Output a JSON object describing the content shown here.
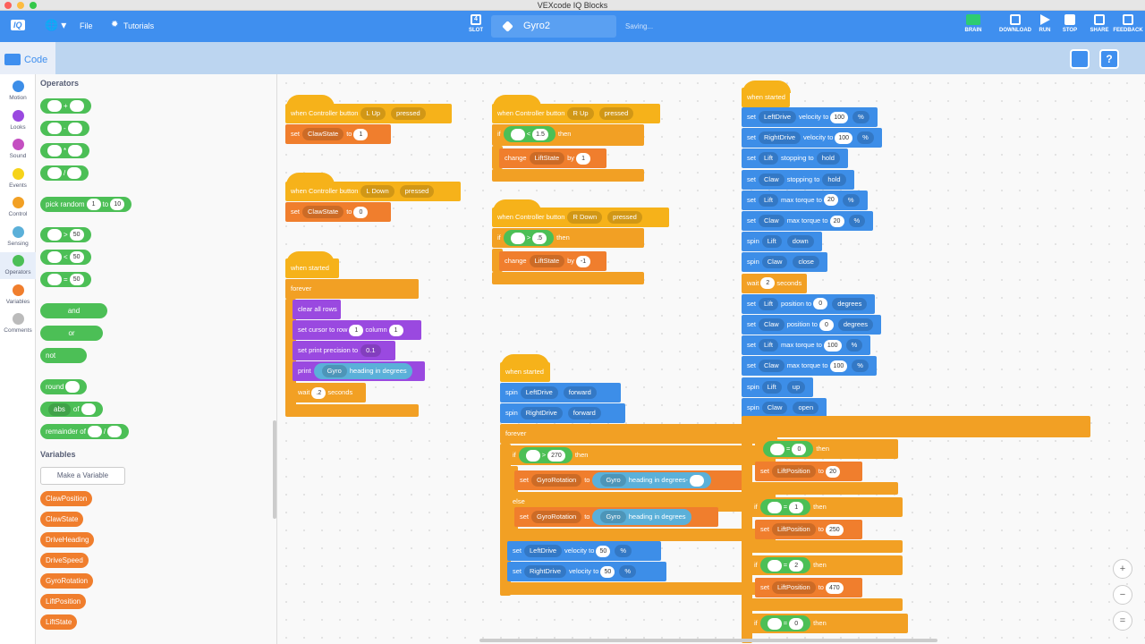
{
  "window": {
    "title": "VEXcode IQ Blocks"
  },
  "appbar": {
    "logo": "IQ",
    "file": "File",
    "tutorials": "Tutorials",
    "slot_label": "SLOT",
    "slot_value": "4",
    "project_name": "Gyro2",
    "status": "Saving...",
    "brain": "BRAIN",
    "download": "DOWNLOAD",
    "run": "RUN",
    "stop": "STOP",
    "share": "SHARE",
    "feedback": "FEEDBACK"
  },
  "code_tab": "Code",
  "categories": [
    {
      "label": "Motion",
      "color": "#3d8ee8"
    },
    {
      "label": "Looks",
      "color": "#9a49e0"
    },
    {
      "label": "Sound",
      "color": "#c44fc1"
    },
    {
      "label": "Events",
      "color": "#f6d31a"
    },
    {
      "label": "Control",
      "color": "#f2a024"
    },
    {
      "label": "Sensing",
      "color": "#5bb0d9"
    },
    {
      "label": "Operators",
      "color": "#4cbf56"
    },
    {
      "label": "Variables",
      "color": "#f07e2d"
    },
    {
      "label": "Comments",
      "color": "#bbbbbb"
    }
  ],
  "palette": {
    "operators_title": "Operators",
    "ops": [
      "+",
      "-",
      "*",
      "/"
    ],
    "pick_random": {
      "label": "pick random",
      "a": "1",
      "to": "to",
      "b": "10"
    },
    "compare": [
      {
        "op": ">",
        "v": "50"
      },
      {
        "op": "<",
        "v": "50"
      },
      {
        "op": "=",
        "v": "50"
      }
    ],
    "logic": [
      "and",
      "or",
      "not"
    ],
    "round": "round",
    "abs": {
      "fn": "abs",
      "of": "of"
    },
    "remainder": {
      "label": "remainder of",
      "sep": "/"
    },
    "variables_title": "Variables",
    "make_variable": "Make a Variable",
    "vars": [
      "ClawPosition",
      "ClawState",
      "DriveHeading",
      "DriveSpeed",
      "GyroRotation",
      "LiftPosition",
      "LiftState"
    ]
  },
  "script1": {
    "when": "when Controller button",
    "btn": "L Up",
    "ev": "pressed",
    "set": "set",
    "var": "ClawState",
    "to": "to",
    "val": "1"
  },
  "script2": {
    "when": "when Controller button",
    "btn": "L Down",
    "ev": "pressed",
    "set": "set",
    "var": "ClawState",
    "to": "to",
    "val": "0"
  },
  "script3": {
    "when": "when started",
    "forever": "forever",
    "clear": "clear all rows",
    "cursor": "set cursor to row",
    "row": "1",
    "column": "column",
    "col": "1",
    "precision": "set print precision to",
    "prec": "0.1",
    "print": "print",
    "gyro": "Gyro",
    "heading": "heading in degrees",
    "wait": "wait",
    "secs": ".2",
    "seconds": "seconds"
  },
  "script4": {
    "when": "when Controller button",
    "btn": "R Up",
    "ev": "pressed",
    "if": "if",
    "var": "LiftState",
    "op": "<",
    "val": "1.5",
    "then": "then",
    "change": "change",
    "by": "by",
    "amt": "1"
  },
  "script5": {
    "when": "when Controller button",
    "btn": "R Down",
    "ev": "pressed",
    "if": "if",
    "var": "LiftState",
    "op": ">",
    "val": ".5",
    "then": "then",
    "change": "change",
    "by": "by",
    "amt": "-1"
  },
  "script6": {
    "when": "when started",
    "spin": "spin",
    "ld": "LeftDrive",
    "rd": "RightDrive",
    "fwd": "forward",
    "forever": "forever",
    "if": "if",
    "gyro": "Gyro",
    "heading": "heading in degrees",
    "gt": ">",
    "v270": "270",
    "then": "then",
    "set": "set",
    "gr": "GyroRotation",
    "to": "to",
    "minus": "-",
    "else": "else",
    "velocity": "velocity to",
    "v50": "50",
    "pct": "%"
  },
  "script7": {
    "when": "when started",
    "rows": [
      [
        "set",
        "LeftDrive",
        "velocity to",
        "100",
        "%"
      ],
      [
        "set",
        "RightDrive",
        "velocity to",
        "100",
        "%"
      ],
      [
        "set",
        "Lift",
        "stopping to",
        "hold",
        ""
      ],
      [
        "set",
        "Claw",
        "stopping to",
        "hold",
        ""
      ],
      [
        "set",
        "Lift",
        "max torque to",
        "20",
        "%"
      ],
      [
        "set",
        "Claw",
        "max torque to",
        "20",
        "%"
      ],
      [
        "spin",
        "Lift",
        "",
        "down",
        ""
      ],
      [
        "spin",
        "Claw",
        "",
        "close",
        ""
      ],
      [
        "wait",
        "",
        "",
        "2",
        "seconds"
      ],
      [
        "set",
        "Lift",
        "position to",
        "0",
        "degrees"
      ],
      [
        "set",
        "Claw",
        "position to",
        "0",
        "degrees"
      ],
      [
        "set",
        "Lift",
        "max torque to",
        "100",
        "%"
      ],
      [
        "set",
        "Claw",
        "max torque to",
        "100",
        "%"
      ],
      [
        "spin",
        "Lift",
        "",
        "up",
        ""
      ],
      [
        "spin",
        "Claw",
        "",
        "open",
        ""
      ]
    ],
    "c1": {
      "var": "LiftState",
      "val": "0",
      "then": "then",
      "set": "set",
      "var2": "LiftPosition",
      "to": "to",
      "v": "20"
    },
    "c2": {
      "if": "if",
      "var": "LiftState",
      "val": "1",
      "then": "then",
      "var2": "LiftPosition",
      "to": "to",
      "v": "250"
    },
    "c3": {
      "if": "if",
      "var": "LiftState",
      "val": "2",
      "then": "then",
      "var2": "LiftPosition",
      "to": "to",
      "v": "470"
    },
    "c4": {
      "if": "if",
      "var": "ClawState",
      "val": "0",
      "then": "then",
      "eq": "="
    }
  }
}
